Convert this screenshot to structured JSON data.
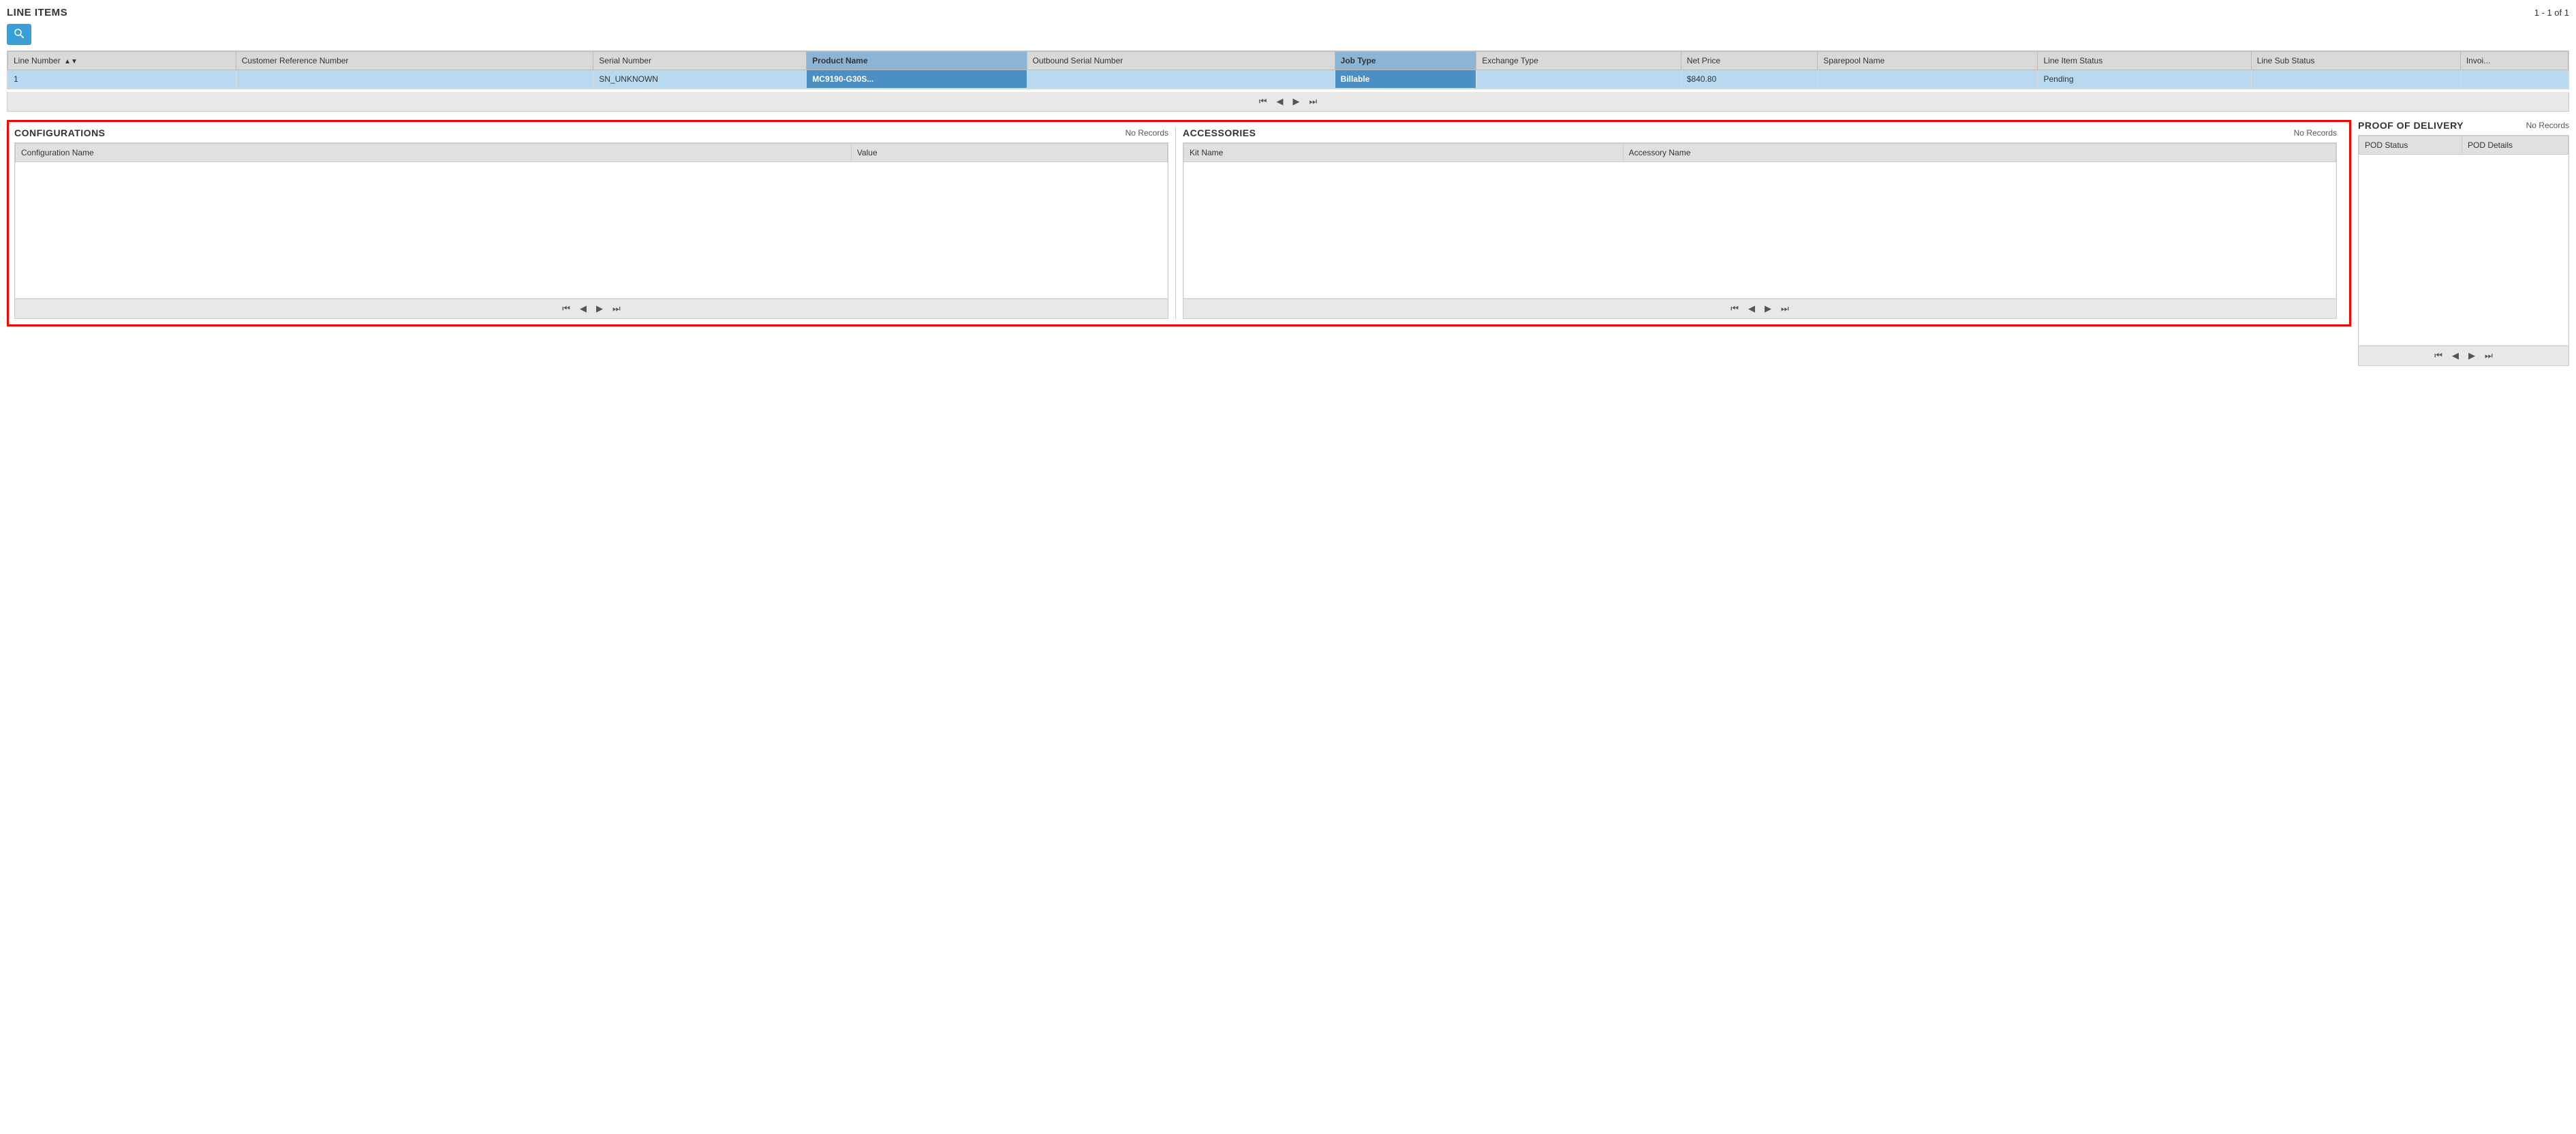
{
  "lineItems": {
    "title": "LINE ITEMS",
    "recordCount": "1 - 1 of 1",
    "searchButton": "🔍",
    "columns": [
      {
        "id": "line_number",
        "label": "Line Number",
        "sortable": true
      },
      {
        "id": "customer_ref",
        "label": "Customer Reference Number"
      },
      {
        "id": "serial_number",
        "label": "Serial Number"
      },
      {
        "id": "product_name",
        "label": "Product Name",
        "active": true
      },
      {
        "id": "outbound_serial",
        "label": "Outbound Serial Number"
      },
      {
        "id": "job_type",
        "label": "Job Type",
        "active": true
      },
      {
        "id": "exchange_type",
        "label": "Exchange Type"
      },
      {
        "id": "net_price",
        "label": "Net Price"
      },
      {
        "id": "sparepool_name",
        "label": "Sparepool Name"
      },
      {
        "id": "line_item_status",
        "label": "Line Item Status"
      },
      {
        "id": "line_sub_status",
        "label": "Line Sub Status"
      },
      {
        "id": "invoice",
        "label": "Invoi..."
      }
    ],
    "rows": [
      {
        "line_number": "1",
        "customer_ref": "",
        "serial_number": "SN_UNKNOWN",
        "product_name": "MC9190-G30S...",
        "outbound_serial": "",
        "job_type": "Billable",
        "exchange_type": "",
        "net_price": "$840.80",
        "sparepool_name": "",
        "line_item_status": "Pending",
        "line_sub_status": "",
        "invoice": ""
      }
    ],
    "pagination": {
      "first": "⏮",
      "prev": "◀",
      "next": "▶",
      "last": "⏭"
    }
  },
  "configurations": {
    "title": "CONFIGURATIONS",
    "noRecords": "No Records",
    "columns": [
      {
        "label": "Configuration Name"
      },
      {
        "label": "Value"
      }
    ],
    "rows": [],
    "pagination": {
      "first": "⏮",
      "prev": "◀",
      "next": "▶",
      "last": "⏭"
    }
  },
  "accessories": {
    "title": "ACCESSORIES",
    "noRecords": "No Records",
    "columns": [
      {
        "label": "Kit Name"
      },
      {
        "label": "Accessory Name"
      }
    ],
    "rows": [],
    "pagination": {
      "first": "⏮",
      "prev": "◀",
      "next": "▶",
      "last": "⏭"
    }
  },
  "proofOfDelivery": {
    "title": "PROOF OF DELIVERY",
    "noRecords": "No Records",
    "columns": [
      {
        "label": "POD Status"
      },
      {
        "label": "POD Details"
      }
    ],
    "rows": [],
    "pagination": {
      "first": "⏮",
      "prev": "◀",
      "next": "▶",
      "last": "⏭"
    }
  }
}
